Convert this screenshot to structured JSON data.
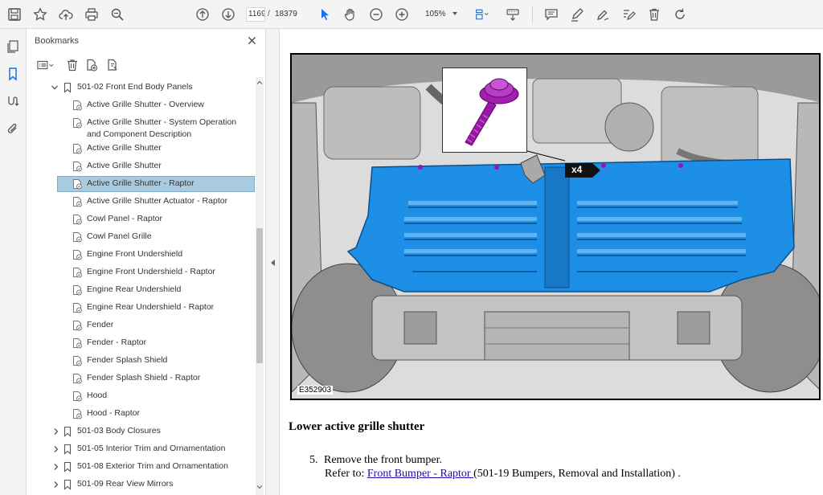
{
  "toolbar": {
    "page_current": "1169",
    "page_separator": "/",
    "page_total": "18379",
    "zoom": "105%"
  },
  "bookmarks": {
    "title": "Bookmarks",
    "parent": "501-02 Front End Body Panels",
    "children": [
      "Active Grille Shutter - Overview",
      "Active Grille Shutter - System Operation and Component Description",
      "Active Grille Shutter",
      "Active Grille Shutter",
      "Active Grille Shutter - Raptor",
      "Active Grille Shutter Actuator - Raptor",
      "Cowl Panel - Raptor",
      "Cowl Panel Grille",
      "Engine Front Undershield",
      "Engine Front Undershield - Raptor",
      "Engine Rear Undershield",
      "Engine Rear Undershield - Raptor",
      "Fender",
      "Fender - Raptor",
      "Fender Splash Shield",
      "Fender Splash Shield - Raptor",
      "Hood",
      "Hood - Raptor"
    ],
    "child_line2": "and Component Description",
    "child_line1": "Active Grille Shutter - System Operation",
    "siblings": [
      "501-03 Body Closures",
      "501-05 Interior Trim and Ornamentation",
      "501-08 Exterior Trim and Ornamentation",
      "501-09 Rear View Mirrors"
    ],
    "selected_index": 4
  },
  "document": {
    "figure_id": "E352903",
    "callout": "x4",
    "heading": "Lower active grille shutter",
    "step_number": "5.",
    "step_text": "Remove the front bumper.",
    "refer_prefix": "Refer to: ",
    "refer_link": "Front Bumper - Raptor ",
    "refer_suffix": "(501-19 Bumpers, Removal and Installation) ."
  },
  "colors": {
    "accent": "#1a73e8",
    "selected": "#a9cbe0",
    "shutter": "#1e8fe6",
    "bolt": "#9b16a8"
  }
}
